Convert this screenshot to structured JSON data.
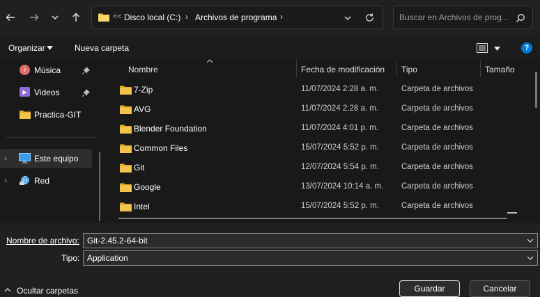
{
  "address": {
    "overflow": "<<",
    "segments": [
      "Disco local (C:)",
      "Archivos de programa"
    ]
  },
  "search": {
    "placeholder": "Buscar en Archivos de prog..."
  },
  "toolbar": {
    "organize_label": "Organizar",
    "new_folder_label": "Nueva carpeta"
  },
  "sidebar": {
    "items": [
      {
        "label": "Música",
        "icon": "music-icon",
        "pinned": true
      },
      {
        "label": "Videos",
        "icon": "video-icon",
        "pinned": true
      },
      {
        "label": "Practica-GIT",
        "icon": "folder-icon",
        "pinned": false
      },
      {
        "label": "Este equipo",
        "icon": "computer-icon",
        "selected": true
      },
      {
        "label": "Red",
        "icon": "network-icon"
      }
    ]
  },
  "columns": {
    "name": "Nombre",
    "date": "Fecha de modificación",
    "type": "Tipo",
    "size": "Tamaño"
  },
  "files": [
    {
      "name": "7-Zip",
      "date": "11/07/2024 2:28 a. m.",
      "type": "Carpeta de archivos"
    },
    {
      "name": "AVG",
      "date": "11/07/2024 2:28 a. m.",
      "type": "Carpeta de archivos"
    },
    {
      "name": "Blender Foundation",
      "date": "11/07/2024 4:01 p. m.",
      "type": "Carpeta de archivos"
    },
    {
      "name": "Common Files",
      "date": "15/07/2024 5:52 p. m.",
      "type": "Carpeta de archivos"
    },
    {
      "name": "Git",
      "date": "12/07/2024 5:54 p. m.",
      "type": "Carpeta de archivos"
    },
    {
      "name": "Google",
      "date": "13/07/2024 10:14 a. m.",
      "type": "Carpeta de archivos"
    },
    {
      "name": "Intel",
      "date": "15/07/2024 5:52 p. m.",
      "type": "Carpeta de archivos"
    }
  ],
  "filename": {
    "label": "Nombre de archivo:",
    "value": "Git-2.45.2-64-bit"
  },
  "filetype": {
    "label": "Tipo:",
    "value": "Application"
  },
  "hide_folders_label": "Ocultar carpetas",
  "actions": {
    "save_label": "Guardar",
    "cancel_label": "Cancelar"
  },
  "colors": {
    "accent": "#0078d4",
    "folder": "#f3c44a",
    "background": "#202020"
  }
}
